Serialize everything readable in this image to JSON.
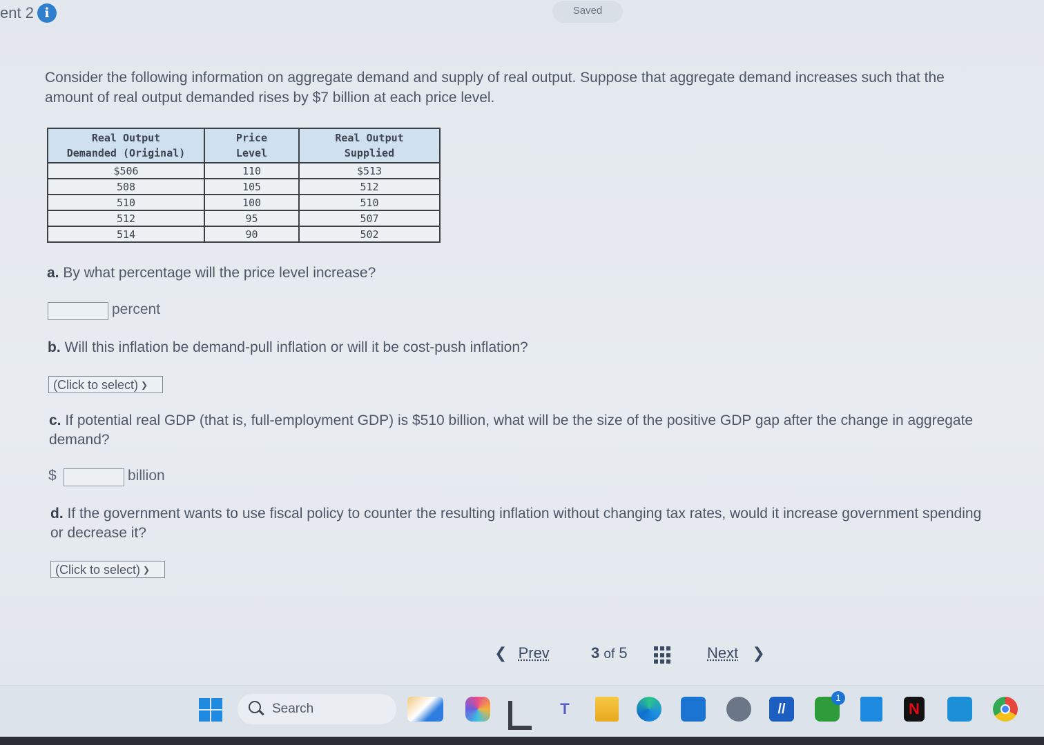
{
  "header": {
    "assignment_title": "ent 2",
    "saved_label": "Saved"
  },
  "intro_text": "Consider the following information on aggregate demand and supply of real output. Suppose that aggregate demand increases such that the amount of real output demanded rises by $7 billion at each price level.",
  "table": {
    "headers": [
      [
        "Real Output",
        "Demanded (Original)"
      ],
      [
        "Price",
        "Level"
      ],
      [
        "Real Output",
        "Supplied"
      ]
    ],
    "rows": [
      [
        "$506",
        "110",
        "$513"
      ],
      [
        "508",
        "105",
        "512"
      ],
      [
        "510",
        "100",
        "510"
      ],
      [
        "512",
        "95",
        "507"
      ],
      [
        "514",
        "90",
        "502"
      ]
    ]
  },
  "questions": {
    "a": {
      "letter": "a.",
      "text": "By what percentage will the price level increase?",
      "unit": "percent"
    },
    "b": {
      "letter": "b.",
      "text": "Will this inflation be demand-pull inflation or will it be cost-push inflation?",
      "select_label": "(Click to select)"
    },
    "c": {
      "letter": "c.",
      "text": "If potential real GDP (that is, full-employment GDP) is $510 billion, what will be the size of the positive GDP gap after the change in aggregate demand?",
      "prefix": "$",
      "unit": "billion"
    },
    "d": {
      "letter": "d.",
      "text": "If the government wants to use fiscal policy to counter the resulting inflation without changing tax rates, would it increase government spending or decrease it?",
      "select_label": "(Click to select)"
    }
  },
  "navigation": {
    "prev_label": "Prev",
    "page_current": "3",
    "page_of": "of",
    "page_total": "5",
    "next_label": "Next"
  },
  "taskbar": {
    "search_label": "Search",
    "badge_count": "1"
  }
}
